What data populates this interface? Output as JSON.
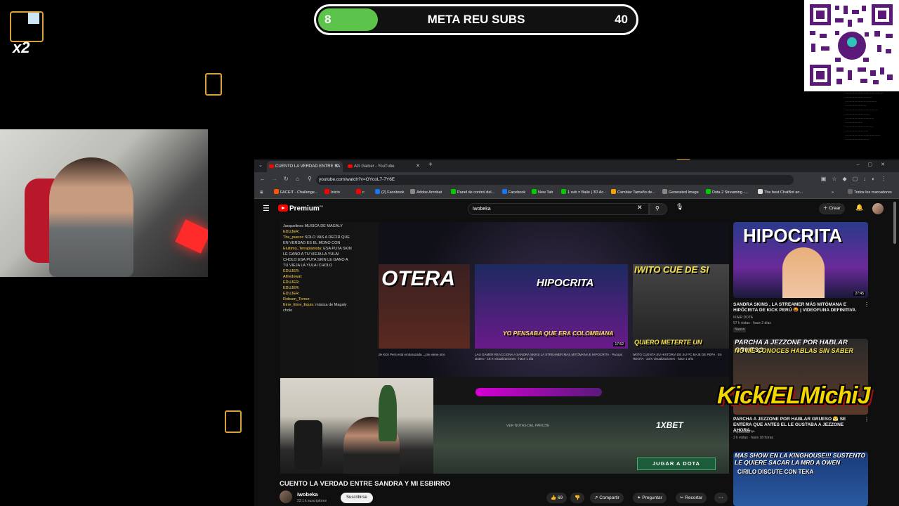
{
  "overlay": {
    "goal": {
      "current": "8",
      "title": "META REU SUBS",
      "target": "40",
      "progress": 0.2,
      "fill_color": "#5cc44a"
    },
    "multiplier": "x2",
    "kick_tag": "Kick/ELMichiJ"
  },
  "browser": {
    "tabs": [
      {
        "label": "CUENTO LA VERDAD ENTRE SA"
      },
      {
        "label": "AG Gamer - YouTube"
      }
    ],
    "url": "youtube.com/watch?v=OYcoL7-7Y6E",
    "bookmarks": [
      "FACEIT - Challenge...",
      "Inicio",
      "c",
      "(2) Facebook",
      "Adobe Acrobat",
      "Panel de control del...",
      "Facebook",
      "New Tab",
      "1 sub = Baile | 3D Ac...",
      "Cambiar Tamaño de...",
      "Generated Image",
      "Dota 2 Streaming -...",
      "The best ChatBot an..."
    ],
    "bookmarks_all": "Todos los marcadores"
  },
  "youtube": {
    "logo_text": "Premium",
    "logo_sup": "PE",
    "search_value": "iwobeka",
    "create_label": "Crear",
    "video": {
      "title": "CUENTO LA VERDAD ENTRE SANDRA Y MI ESBIRRO",
      "channel": "iwobeka",
      "subscribers": "23.1 k suscriptores",
      "subscribe_label": "Suscribirse",
      "likes": "69",
      "share_label": "Compartir",
      "ask_label": "Preguntar",
      "clip_label": "Recortar"
    },
    "player": {
      "chat": [
        {
          "user": "",
          "text": "Jacquelines  MUSICA DE MAGALY"
        },
        {
          "user": "EDUJER:",
          "text": ""
        },
        {
          "user": "The_pueroc",
          "text": "SOLO VAS A DECIR QUE EN VERDAD ES EL MONO CON"
        },
        {
          "user": "Elultimo_Terraplanista:",
          "text": "ESA PUTA SKIN LE GANO A TU VIEJA LA YULAI CHOLO ESA PUTA SKIN LE GANO A TU VIEJA LA YULAI CHOLO"
        },
        {
          "user": "EDUJER:",
          "text": ""
        },
        {
          "user": "Alfredowal:",
          "text": ""
        },
        {
          "user": "EDUJER:",
          "text": ""
        },
        {
          "user": "EDUJER:",
          "text": ""
        },
        {
          "user": "EDUJER:",
          "text": ""
        },
        {
          "user": "Robson_Torrez:",
          "text": ""
        },
        {
          "user": "Eirre_Eirre_Equis:",
          "text": "música de Magaly cholo"
        }
      ],
      "thumbs": [
        {
          "title": "OTERA",
          "caption": "de Kick Perú está embarazada...¿Se viene otro"
        },
        {
          "title": "HIPOCRITA",
          "subtitle": "YO PENSABA QUE ERA COLOMBIANA",
          "caption": "LAU GAMER REACCIONA A SANDRA SKINS LA STREAMER MAS MITÓMANA E HIPOCRITA · Pocopo Dotero · 18 K visualizaciones · hace 1 día",
          "duration": "17:52"
        },
        {
          "title": "IWITO CUE DE SI",
          "subtitle": "QUIERO METERTE UN",
          "caption": "IWITO CUENTA SU HISTORIA DE SU PC BAJE DE PEPA · En HDOTA · 23 K visualizaciones · hace 1 año"
        }
      ],
      "patch_notes": "VER NOTAS DEL PARCHE",
      "cta": "JUGAR A DOTA",
      "sponsor": "1XBET"
    },
    "recommendations": [
      {
        "thumb_text": "HIPOCRITA",
        "duration": "27:45",
        "title": "SANDRA SKINS , LA STREAMER MÁS MITÓMANA E HIPÓCRITA DE KICK PERÚ 🤬 | VIDEOFUNA DEFINITIVA",
        "channel": "IKAIR DOTA",
        "meta": "97 k vistas · hace 2 días",
        "badge": "Nuevo"
      },
      {
        "thumb_text": "PARCHA A JEZZONE POR HABLAR GRUESO",
        "thumb_sub": "NO ME CONOCES HABLAS SIN SABER",
        "title": "PARCHA A JEZZONE POR HABLAR GRUESO 😤 SE ENTERA QUE ANTES EL LE GUSTABA A JEZZONE AHORA ...",
        "channel": "PepoDotaTV",
        "meta": "2 k vistas · hace 18 horas"
      },
      {
        "thumb_text": "MAS SHOW EN LA KINGHOUSE!!! SUSTENTO LE QUIERE SACAR LA MRD A OWEN",
        "thumb_sub": "CIRILO DISCUTE CON TEKA"
      }
    ]
  }
}
